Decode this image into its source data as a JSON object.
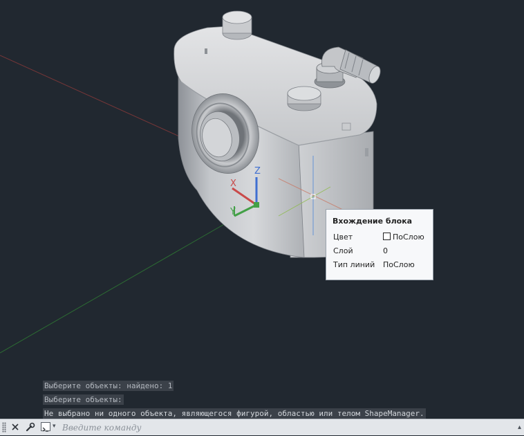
{
  "tooltip": {
    "title": "Вхождение блока",
    "rows": [
      {
        "label": "Цвет",
        "value": "ПоСлою",
        "swatch": "#ffffff"
      },
      {
        "label": "Слой",
        "value": "0"
      },
      {
        "label": "Тип линий",
        "value": "ПоСлою"
      }
    ]
  },
  "command_history": [
    "Выберите объекты: найдено: 1",
    "Выберите объекты:",
    "Не выбрано ни одного объекта, являющегося фигурой, областью или телом ShapeManager."
  ],
  "command_line": {
    "placeholder": "Введите команду",
    "value": ""
  },
  "ucs_labels": {
    "x": "X",
    "y": "Y",
    "z": "Z"
  },
  "icons": {
    "close": "close-icon",
    "customize": "wrench-icon",
    "prompt": "command-prompt-icon",
    "recent": "chevron-down-icon",
    "end": "chevron-up-icon"
  },
  "colors": {
    "background": "#212830",
    "x_axis": "#c94a4a",
    "y_axis": "#43a047",
    "z_axis": "#3f6fd1"
  }
}
